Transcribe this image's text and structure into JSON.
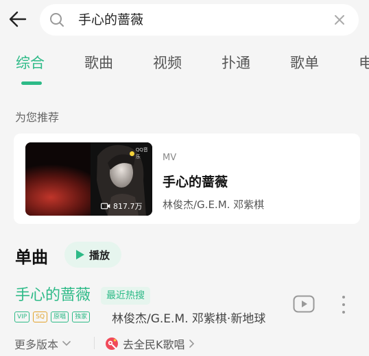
{
  "search": {
    "query": "手心的蔷薇"
  },
  "tabs": [
    {
      "label": "综合",
      "active": true
    },
    {
      "label": "歌曲",
      "active": false
    },
    {
      "label": "视频",
      "active": false
    },
    {
      "label": "扑通",
      "active": false
    },
    {
      "label": "歌单",
      "active": false
    },
    {
      "label": "电",
      "active": false
    }
  ],
  "recommend": {
    "section_label": "为您推荐",
    "mv": {
      "type": "MV",
      "title": "手心的蔷薇",
      "artist": "林俊杰/G.E.M. 邓紫棋",
      "play_count": "817.7万",
      "watermark": "QQ音乐"
    }
  },
  "singles": {
    "title": "单曲",
    "play_all_label": "播放",
    "song": {
      "title": "手心的蔷薇",
      "badge": "最近热搜",
      "tags": [
        "VIP",
        "SQ",
        "原唱",
        "独家"
      ],
      "artist": "林俊杰/G.E.M. 邓紫棋·新地球",
      "more_versions": "更多版本",
      "ksong": "去全民K歌唱"
    }
  },
  "colors": {
    "accent": "#2dba87",
    "sq_tag": "#e2a22b",
    "background": "#f5f5f5"
  }
}
